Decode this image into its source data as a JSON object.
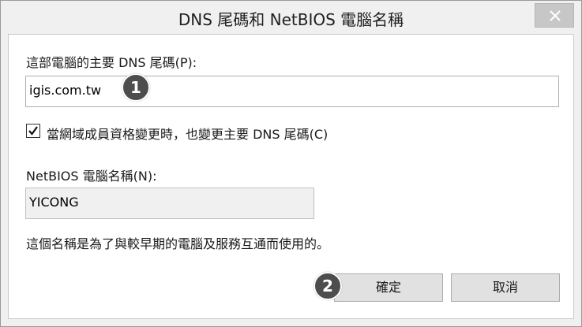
{
  "window": {
    "title": "DNS 尾碼和 NetBIOS 電腦名稱"
  },
  "primary_dns_suffix": {
    "label": "這部電腦的主要 DNS 尾碼(P):",
    "value": "igis.com.tw"
  },
  "change_suffix_checkbox": {
    "label": "當網域成員資格變更時，也變更主要 DNS 尾碼(C)",
    "checked": true
  },
  "netbios_name": {
    "label": "NetBIOS 電腦名稱(N):",
    "value": "YICONG"
  },
  "note": "這個名稱是為了與較早期的電腦及服務互通而使用的。",
  "buttons": {
    "ok_label": "確定",
    "cancel_label": "取消"
  },
  "annotations": {
    "step1": "1",
    "step2": "2"
  },
  "icons": {
    "close": "close-icon",
    "check": "checkmark-icon"
  }
}
